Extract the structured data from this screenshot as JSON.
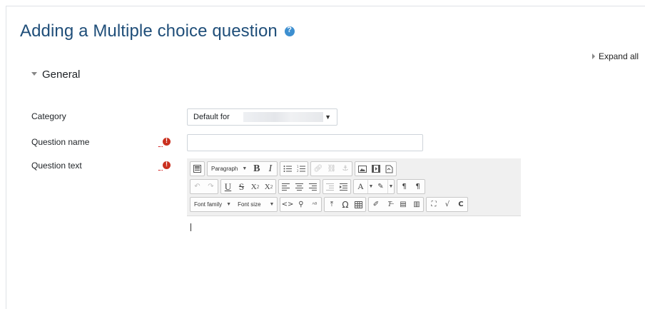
{
  "page": {
    "title": "Adding a Multiple choice question",
    "expand_all": "Expand all"
  },
  "section": {
    "title": "General"
  },
  "fields": {
    "category": {
      "label": "Category",
      "value": "Default for"
    },
    "question_name": {
      "label": "Question name",
      "value": ""
    },
    "question_text": {
      "label": "Question text"
    }
  },
  "editor": {
    "paragraph": "Paragraph",
    "font_family": "Font family",
    "font_size": "Font size"
  },
  "colors": {
    "title": "#1f4e79",
    "required": "#ca3120",
    "help": "#3d8fd0"
  }
}
